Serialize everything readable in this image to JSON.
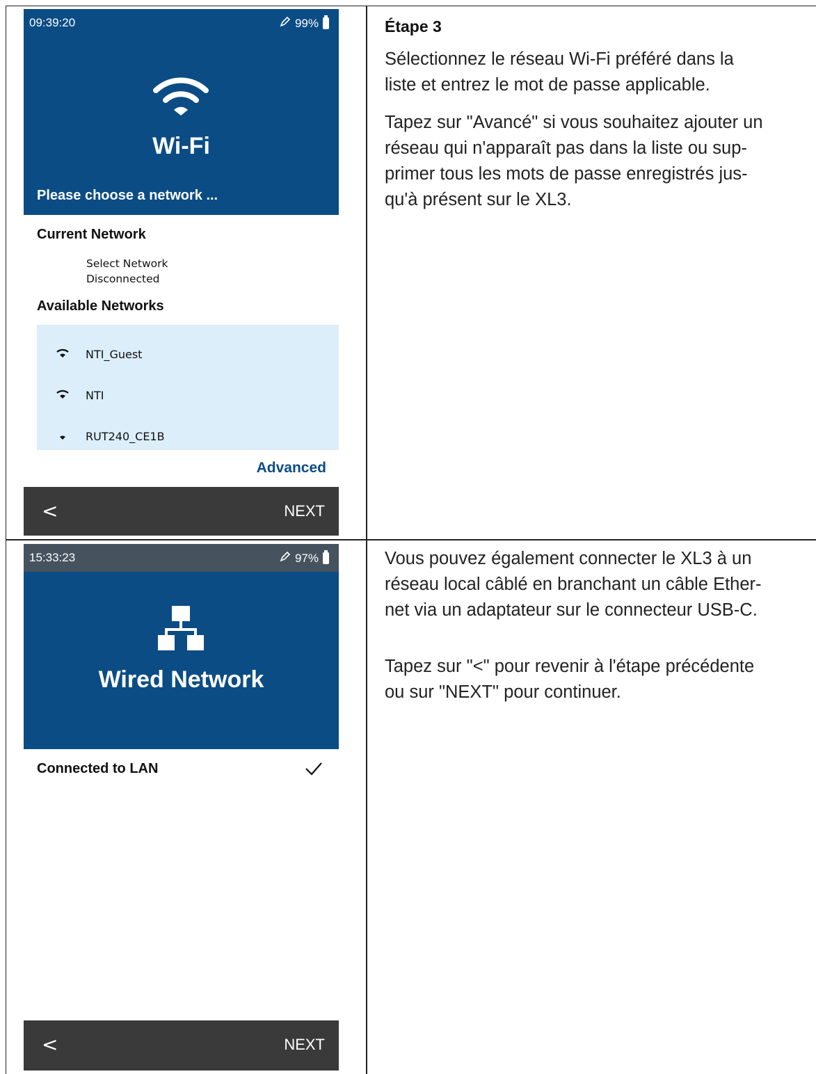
{
  "step1": {
    "status": {
      "time": "09:39:20",
      "battery": "99%"
    },
    "title": "Wi-Fi",
    "subtitle": "Please choose a network ...",
    "current_label": "Current Network",
    "current_name": "Select Network",
    "current_state": "Disconnected",
    "available_label": "Available Networks",
    "networks": [
      {
        "name": "NTI_Guest",
        "signal": "full"
      },
      {
        "name": "NTI",
        "signal": "full"
      },
      {
        "name": "RUT240_CE1B",
        "signal": "low"
      }
    ],
    "advanced": "Advanced",
    "back": "<",
    "next": "NEXT",
    "colors": {
      "header": "#0b4c85",
      "list_bg": "#dceefa",
      "footer": "#3a3a3a"
    }
  },
  "step2": {
    "status": {
      "time": "15:33:23",
      "battery": "97%"
    },
    "title": "Wired Network",
    "connected": "Connected to LAN",
    "back": "<",
    "next": "NEXT"
  },
  "instructions": {
    "heading": "Étape 3",
    "p1_line1": "Sélectionnez le réseau Wi-Fi   préféré dans la",
    "p1_line2": "liste et entrez le mot de passe applicable.",
    "p2_line1": "Tapez sur \"Avancé\" si vous souhaitez ajouter un",
    "p2_line2": "réseau qui n'apparaît pas dans la liste ou sup-",
    "p2_line3": "primer tous les mots de passe enregistrés jus-",
    "p2_line4": "qu'à présent sur le XL3.",
    "p3_line1": "Vous pouvez également connecter le XL3 à un",
    "p3_line2": "réseau local câblé en branchant un câble Ether-",
    "p3_line3": "net via un adaptateur sur le connecteur USB-C.",
    "p4_line1": "Tapez sur \"<\" pour revenir à l'étape précédente",
    "p4_line2": "ou sur \"NEXT\" pour continuer."
  }
}
